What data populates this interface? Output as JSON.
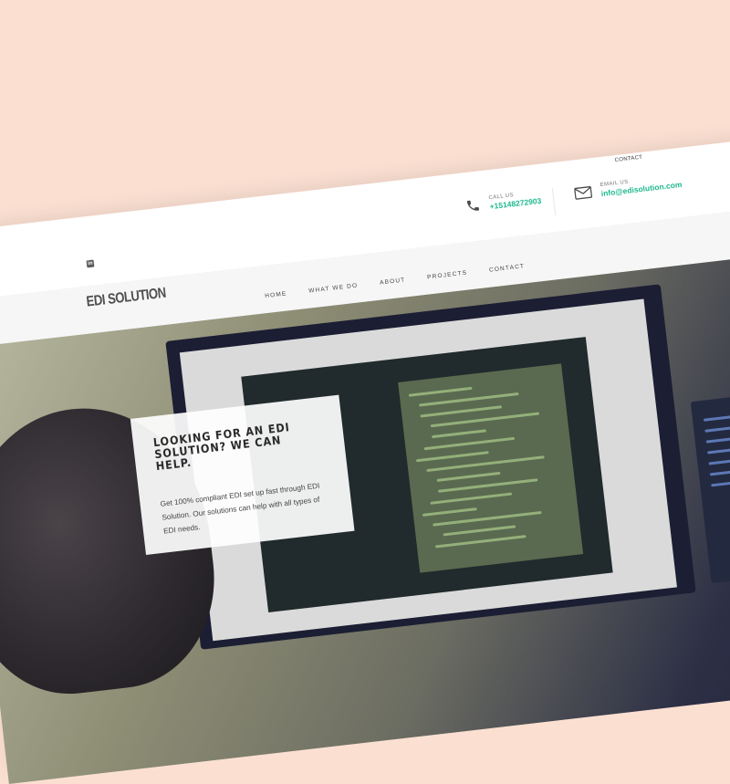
{
  "topbar": {
    "contact_label": "CONTACT"
  },
  "contact_info": {
    "call_label": "CALL US",
    "call_value": "+15148272903",
    "email_label": "EMAIL US",
    "email_value": "info@edisolution.com"
  },
  "logo": {
    "text": "EDI SOLUTION"
  },
  "nav": {
    "items": [
      {
        "label": "HOME"
      },
      {
        "label": "WHAT WE DO"
      },
      {
        "label": "ABOUT"
      },
      {
        "label": "PROJECTS"
      },
      {
        "label": "CONTACT"
      }
    ]
  },
  "hero": {
    "heading": "LOOKING FOR AN EDI SOLUTION? WE CAN HELP.",
    "body": "Get 100% compliant EDI set up fast through EDI Solution. Our solutions can help with all types of EDI needs."
  },
  "colors": {
    "accent": "#1fb98f",
    "background": "#fbe0d2"
  },
  "icons": {
    "social": "linkedin-icon",
    "phone": "phone-icon",
    "email": "mail-icon"
  }
}
